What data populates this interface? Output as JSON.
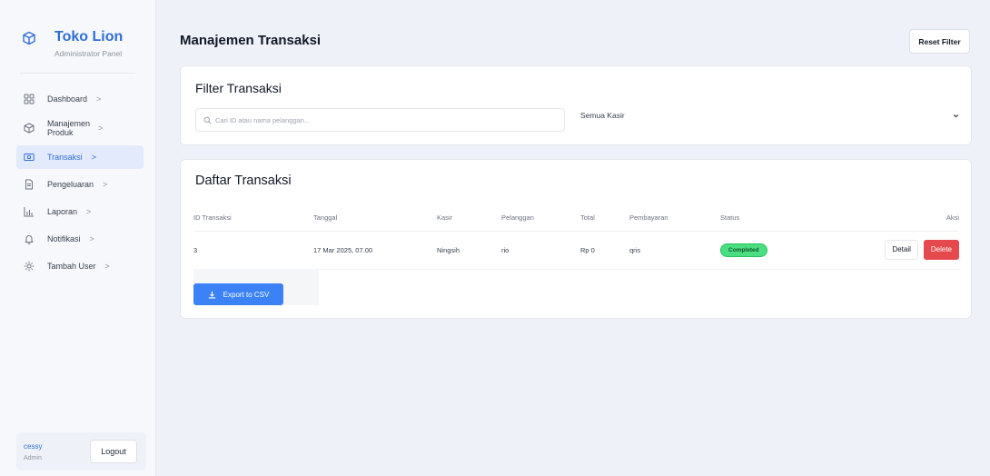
{
  "brand": {
    "title": "Toko Lion",
    "subtitle": "Administrator Panel"
  },
  "sidebar": {
    "items": [
      {
        "label": "Dashboard",
        "icon": "dashboard-grid-icon",
        "active": false
      },
      {
        "label": "Manajemen Produk",
        "icon": "box-icon",
        "active": false
      },
      {
        "label": "Transaksi",
        "icon": "card-icon",
        "active": true
      },
      {
        "label": "Pengeluaran",
        "icon": "document-icon",
        "active": false
      },
      {
        "label": "Laporan",
        "icon": "chart-icon",
        "active": false
      },
      {
        "label": "Notifikasi",
        "icon": "bell-icon",
        "active": false
      },
      {
        "label": "Tambah User",
        "icon": "gear-icon",
        "active": false
      }
    ],
    "chevron": ">"
  },
  "user": {
    "name": "cessy",
    "role": "Admin",
    "logout_label": "Logout"
  },
  "header": {
    "title": "Manajemen Transaksi",
    "reset_label": "Reset Filter"
  },
  "filter": {
    "title": "Filter Transaksi",
    "search_placeholder": "Cari ID atau nama pelanggan...",
    "search_value": "",
    "cashier_selected": "Semua Kasir"
  },
  "transactions": {
    "title": "Daftar Transaksi",
    "columns": [
      "ID Transaksi",
      "Tanggal",
      "Kasir",
      "Pelanggan",
      "Total",
      "Pembayaran",
      "Status",
      "Aksi"
    ],
    "rows": [
      {
        "id": "3",
        "date": "17 Mar 2025, 07.00",
        "cashier": "Ningsih",
        "customer": "rio",
        "total": "Rp 0",
        "payment": "qris",
        "status": "Completed"
      }
    ],
    "detail_label": "Detail",
    "delete_label": "Delete",
    "export_label": "Export to CSV"
  },
  "colors": {
    "accent": "#2f6fd6",
    "button_blue": "#3b82f6",
    "danger": "#e5484d",
    "success": "#4ade80",
    "background": "#eef2f8"
  }
}
